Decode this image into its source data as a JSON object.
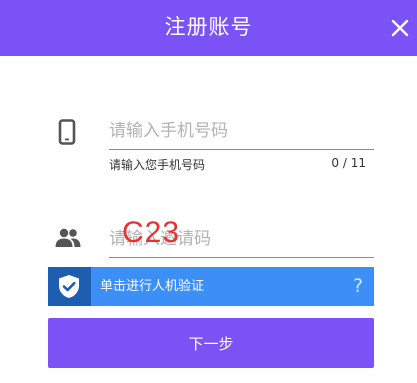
{
  "header": {
    "title": "注册账号",
    "close_icon": "close-icon",
    "background": "#7b52f5"
  },
  "form": {
    "phone": {
      "icon": "smartphone-icon",
      "value": "",
      "placeholder": "请输入手机号码",
      "hint": "请输入您手机号码",
      "counter": "0 / 11"
    },
    "invite": {
      "icon": "people-icon",
      "value": "",
      "placeholder": "请输入邀请码"
    },
    "captcha": {
      "icon": "shield-check-icon",
      "label": "单击进行人机验证",
      "help": "?",
      "color": "#3b8ff7"
    },
    "next_button": {
      "label": "下一步",
      "color": "#7b52f5"
    }
  },
  "watermark": "C23"
}
